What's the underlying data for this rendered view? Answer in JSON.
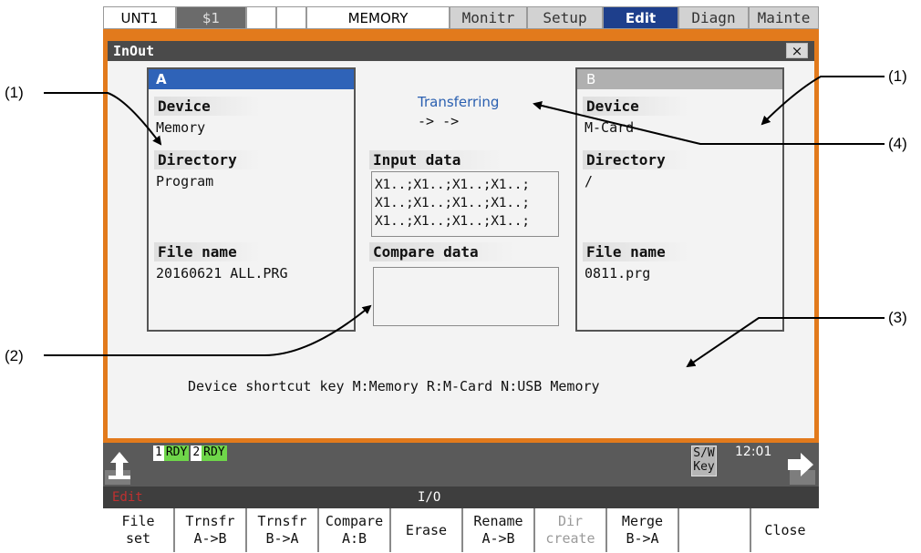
{
  "tabs": [
    "UNT1",
    "$1",
    "",
    "",
    "MEMORY",
    "Monitr",
    "Setup",
    "Edit",
    "Diagn",
    "Mainte"
  ],
  "dialog": {
    "title": "InOut",
    "close_symbol": "×"
  },
  "panel_a": {
    "header": "A",
    "device_label": "Device",
    "device": "Memory",
    "directory_label": "Directory",
    "directory": "Program",
    "filename_label": "File name",
    "filename": "20160621 ALL.PRG"
  },
  "panel_b": {
    "header": "B",
    "device_label": "Device",
    "device": "M-Card",
    "directory_label": "Directory",
    "directory": "/",
    "filename_label": "File name",
    "filename": "0811.prg"
  },
  "center": {
    "status": "Transferring",
    "arrows": "-> ->",
    "input_label": "Input data",
    "input_lines": [
      "X1..;X1..;X1..;X1..;",
      "X1..;X1..;X1..;X1..;",
      "X1..;X1..;X1..;X1..;"
    ],
    "compare_label": "Compare data"
  },
  "shortcut": "Device shortcut key M:Memory R:M-Card N:USB Memory",
  "status_bar": {
    "rdy1_num": "1",
    "rdy1": "RDY",
    "rdy2_num": "2",
    "rdy2": "RDY",
    "sw_key_1": "S/W",
    "sw_key_2": "Key",
    "time": "12:01"
  },
  "menu_bar": {
    "mode": "Edit",
    "title": "I/O"
  },
  "function_keys": [
    {
      "l1": "File",
      "l2": "set"
    },
    {
      "l1": "Trnsfr",
      "l2": "A->B"
    },
    {
      "l1": "Trnsfr",
      "l2": "B->A"
    },
    {
      "l1": "Compare",
      "l2": "A:B"
    },
    {
      "l1": "Erase",
      "l2": ""
    },
    {
      "l1": "Rename",
      "l2": "A->B"
    },
    {
      "l1": "Dir",
      "l2": "create"
    },
    {
      "l1": "Merge",
      "l2": "B->A"
    },
    {
      "l1": "",
      "l2": ""
    },
    {
      "l1": "Close",
      "l2": ""
    }
  ],
  "annotations": [
    "(1)",
    "(1)",
    "(2)",
    "(3)",
    "(4)"
  ],
  "colors": {
    "active_tab": "#1e3f8c",
    "frame": "#e27a1c",
    "rdy_green": "#6fd64a",
    "status_blue": "#2a5fb0"
  }
}
